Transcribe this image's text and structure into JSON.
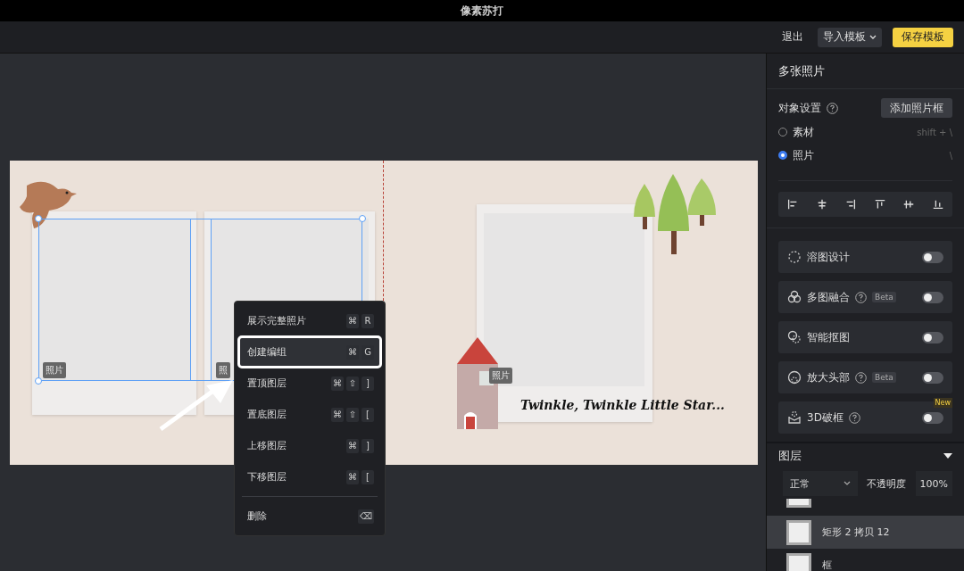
{
  "window": {
    "title": "像素苏打"
  },
  "toolbar": {
    "exit": "退出",
    "import_button": "导入模板",
    "save_button": "保存模板"
  },
  "canvas": {
    "frame_labels": [
      "照片",
      "照",
      "照片"
    ],
    "caption": "Twinkle, Twinkle Little Star...",
    "context_menu": [
      {
        "label": "展示完整照片",
        "keys": [
          "⌘",
          "R"
        ],
        "selected": false
      },
      {
        "label": "创建编组",
        "keys": [
          "⌘",
          "G"
        ],
        "selected": true
      },
      {
        "label": "置顶图层",
        "keys": [
          "⌘",
          "⇧",
          "]"
        ],
        "selected": false
      },
      {
        "label": "置底图层",
        "keys": [
          "⌘",
          "⇧",
          "["
        ],
        "selected": false
      },
      {
        "label": "上移图层",
        "keys": [
          "⌘",
          "]"
        ],
        "selected": false
      },
      {
        "label": "下移图层",
        "keys": [
          "⌘",
          "["
        ],
        "selected": false
      },
      {
        "label": "删除",
        "keys": [
          "⌫"
        ],
        "selected": false
      }
    ]
  },
  "panel": {
    "title": "多张照片",
    "object_settings": "对象设置",
    "add_frame_button": "添加照片框",
    "modes": [
      {
        "label": "素材",
        "shortcut": "shift + \\",
        "selected": false
      },
      {
        "label": "照片",
        "shortcut": "\\",
        "selected": true
      }
    ],
    "features": [
      {
        "label": "溶图设计",
        "help": false,
        "on": false
      },
      {
        "label": "多图融合",
        "help": true,
        "badge": "Beta",
        "on": false
      },
      {
        "label": "智能抠图",
        "help": false,
        "on": false
      },
      {
        "label": "放大头部",
        "help": true,
        "badge": "Beta",
        "on": false
      },
      {
        "label": "3D破框",
        "help": true,
        "new_badge": "New",
        "on": false
      }
    ],
    "layers": {
      "title": "图层",
      "blend_mode": "正常",
      "opacity_label": "不透明度",
      "opacity_value": "100%",
      "items": [
        {
          "name": "矩形 2 拷贝 12",
          "selected": true
        },
        {
          "name": "框",
          "selected": false
        }
      ]
    }
  }
}
